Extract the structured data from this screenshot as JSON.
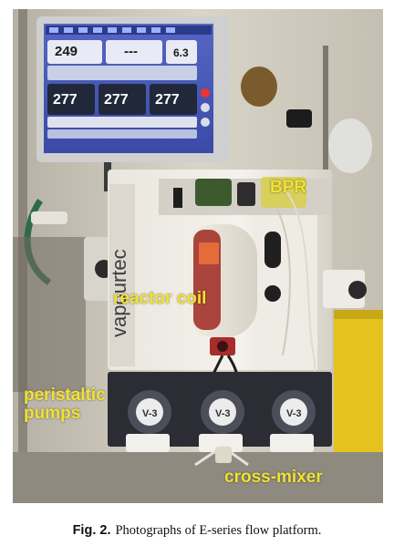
{
  "photo": {
    "labels": {
      "bpr": "BPR",
      "reactor_coil": "reactor coil",
      "peristaltic_pumps": "peristaltic pumps",
      "cross_mixer": "cross-mixer"
    },
    "brand": "vapourtec",
    "screen": {
      "top_value": "249",
      "top_dash": "---",
      "right_badge": "6.3",
      "reactor_values": [
        "277",
        "277",
        "277"
      ]
    },
    "pump_labels": [
      "V-3",
      "V-3",
      "V-3"
    ]
  },
  "caption": {
    "figure_label": "Fig. 2.",
    "text": "Photographs of E-series flow platform."
  }
}
